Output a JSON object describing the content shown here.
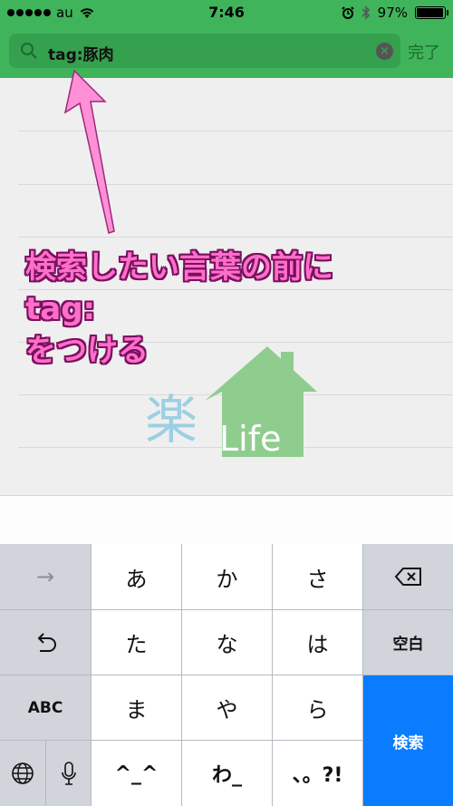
{
  "status_bar": {
    "carrier": "au",
    "time": "7:46",
    "battery_percent_label": "97%",
    "battery_level": 0.97,
    "signal_icon": "signal-dots-icon",
    "wifi_icon": "wifi-icon",
    "alarm_icon": "alarm-icon",
    "bluetooth_icon": "bluetooth-icon"
  },
  "search": {
    "value": "tag:豚肉",
    "done_label": "完了",
    "clear_icon": "clear-icon",
    "search_icon": "search-icon"
  },
  "annotation": {
    "line1": "検索したい言葉の前に",
    "line2": "tag:",
    "line3": "をつける"
  },
  "logo": {
    "kanji": "楽",
    "word": "Life"
  },
  "keyboard": {
    "row1": [
      "→",
      "あ",
      "か",
      "さ",
      "⌫"
    ],
    "row2": [
      "↺",
      "た",
      "な",
      "は",
      "空白"
    ],
    "row3": [
      "ABC",
      "ま",
      "や",
      "ら",
      "検索"
    ],
    "row4": [
      "🌐",
      "🎤",
      "^_^",
      "わ_",
      "、。?!"
    ]
  },
  "colors": {
    "header_green": "#3fb45a",
    "annotation_pink": "#ff6fc9",
    "keyboard_blue": "#0a7cff"
  }
}
